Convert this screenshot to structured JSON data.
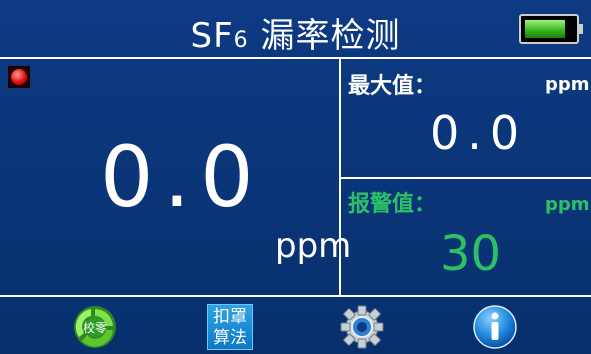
{
  "header": {
    "title_prefix": "SF",
    "title_sub": "6",
    "title_rest": " 漏率检测"
  },
  "main": {
    "value": "0.0",
    "unit": "ppm"
  },
  "max_panel": {
    "label": "最大值：",
    "unit": "ppm",
    "value": "0.0"
  },
  "alarm_panel": {
    "label": "报警值：",
    "unit": "ppm",
    "value": "30"
  },
  "toolbar": {
    "calibrate_label": "校零",
    "calc_label_line1": "扣罩",
    "calc_label_line2": "算法"
  },
  "colors": {
    "background": "#0b3478",
    "alarm_green": "#2bc267",
    "battery_green": "#33b51d"
  },
  "icons": [
    "alarm-led-icon",
    "battery-icon",
    "recycle-icon",
    "gear-icon",
    "info-icon"
  ]
}
